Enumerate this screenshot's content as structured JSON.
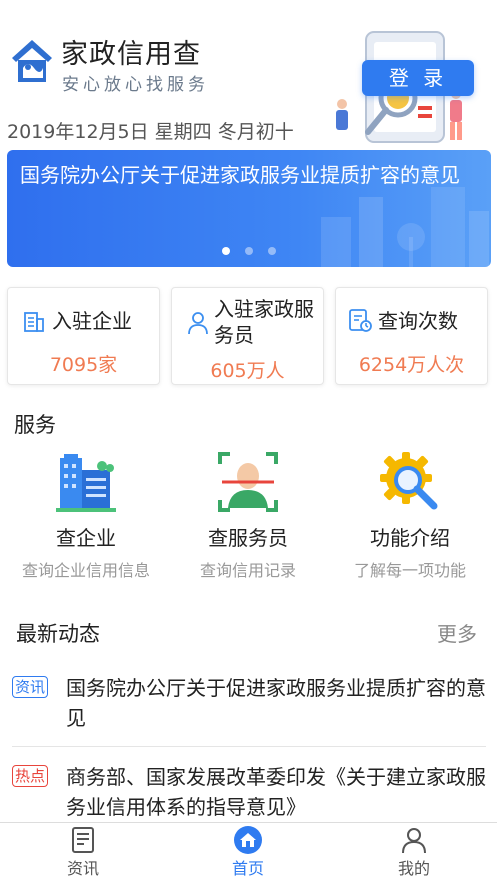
{
  "header": {
    "app_title": "家政信用查",
    "slogan": "安心放心找服务",
    "login_label": "登 录",
    "date_text": "2019年12月5日 星期四 冬月初十"
  },
  "banner": {
    "text": "国务院办公厅关于促进家政服务业提质扩容的意见",
    "slide_count": 3,
    "active_slide": 1
  },
  "stats": [
    {
      "icon": "building-icon",
      "label": "入驻企业",
      "value": "7095家"
    },
    {
      "icon": "person-icon",
      "label": "入驻家政服务员",
      "value": "605万人"
    },
    {
      "icon": "search-doc-icon",
      "label": "查询次数",
      "value": "6254万人次"
    }
  ],
  "services": {
    "title": "服务",
    "items": [
      {
        "icon": "company-building-icon",
        "name": "查企业",
        "desc": "查询企业信用信息"
      },
      {
        "icon": "face-scan-icon",
        "name": "查服务员",
        "desc": "查询信用记录"
      },
      {
        "icon": "gear-magnifier-icon",
        "name": "功能介绍",
        "desc": "了解每一项功能"
      }
    ]
  },
  "news": {
    "title": "最新动态",
    "more_label": "更多",
    "items": [
      {
        "tag": "资讯",
        "tag_color": "#2f7bf0",
        "text": "国务院办公厅关于促进家政服务业提质扩容的意见"
      },
      {
        "tag": "热点",
        "tag_color": "#e8453c",
        "text": "商务部、国家发展改革委印发《关于建立家政服务业信用体系的指导意见》"
      }
    ]
  },
  "tabbar": {
    "items": [
      {
        "icon": "news-icon",
        "label": "资讯",
        "active": false
      },
      {
        "icon": "home-icon",
        "label": "首页",
        "active": true
      },
      {
        "icon": "user-icon",
        "label": "我的",
        "active": false
      }
    ]
  },
  "colors": {
    "accent": "#2f7bf0",
    "stat_value": "#f07b52",
    "hot_tag": "#e8453c"
  }
}
